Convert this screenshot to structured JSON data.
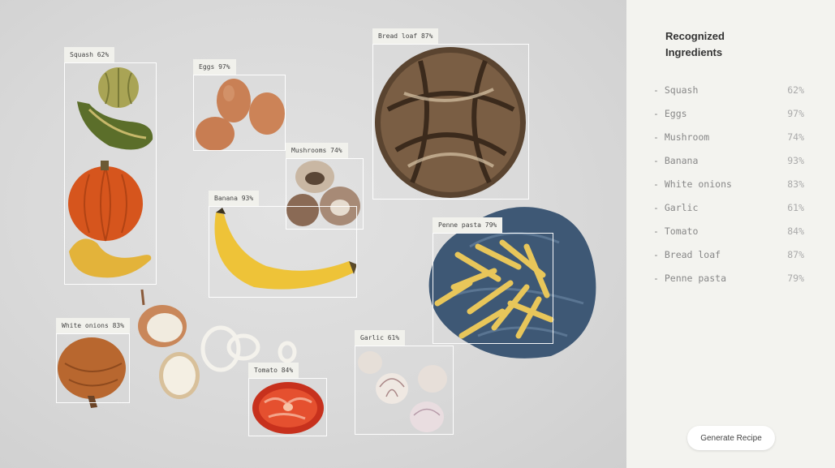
{
  "detections": [
    {
      "id": "squash",
      "label": "Squash 62%"
    },
    {
      "id": "eggs",
      "label": "Eggs 97%"
    },
    {
      "id": "bread",
      "label": "Bread loaf 87%"
    },
    {
      "id": "mushrooms",
      "label": "Mushrooms 74%"
    },
    {
      "id": "banana",
      "label": "Banana 93%"
    },
    {
      "id": "penne",
      "label": "Penne pasta 79%"
    },
    {
      "id": "onions",
      "label": "White onions 83%"
    },
    {
      "id": "garlic",
      "label": "Garlic 61%"
    },
    {
      "id": "tomato",
      "label": "Tomato 84%"
    }
  ],
  "panel": {
    "title": "Recognized Ingredients",
    "items": [
      {
        "name": "- Squash",
        "pct": "62%"
      },
      {
        "name": "- Eggs",
        "pct": "97%"
      },
      {
        "name": "- Mushroom",
        "pct": "74%"
      },
      {
        "name": "- Banana",
        "pct": "93%"
      },
      {
        "name": "- White onions",
        "pct": "83%"
      },
      {
        "name": "- Garlic",
        "pct": "61%"
      },
      {
        "name": "- Tomato",
        "pct": "84%"
      },
      {
        "name": "- Bread loaf",
        "pct": "87%"
      },
      {
        "name": "- Penne pasta",
        "pct": "79%"
      }
    ],
    "button": "Generate Recipe"
  }
}
